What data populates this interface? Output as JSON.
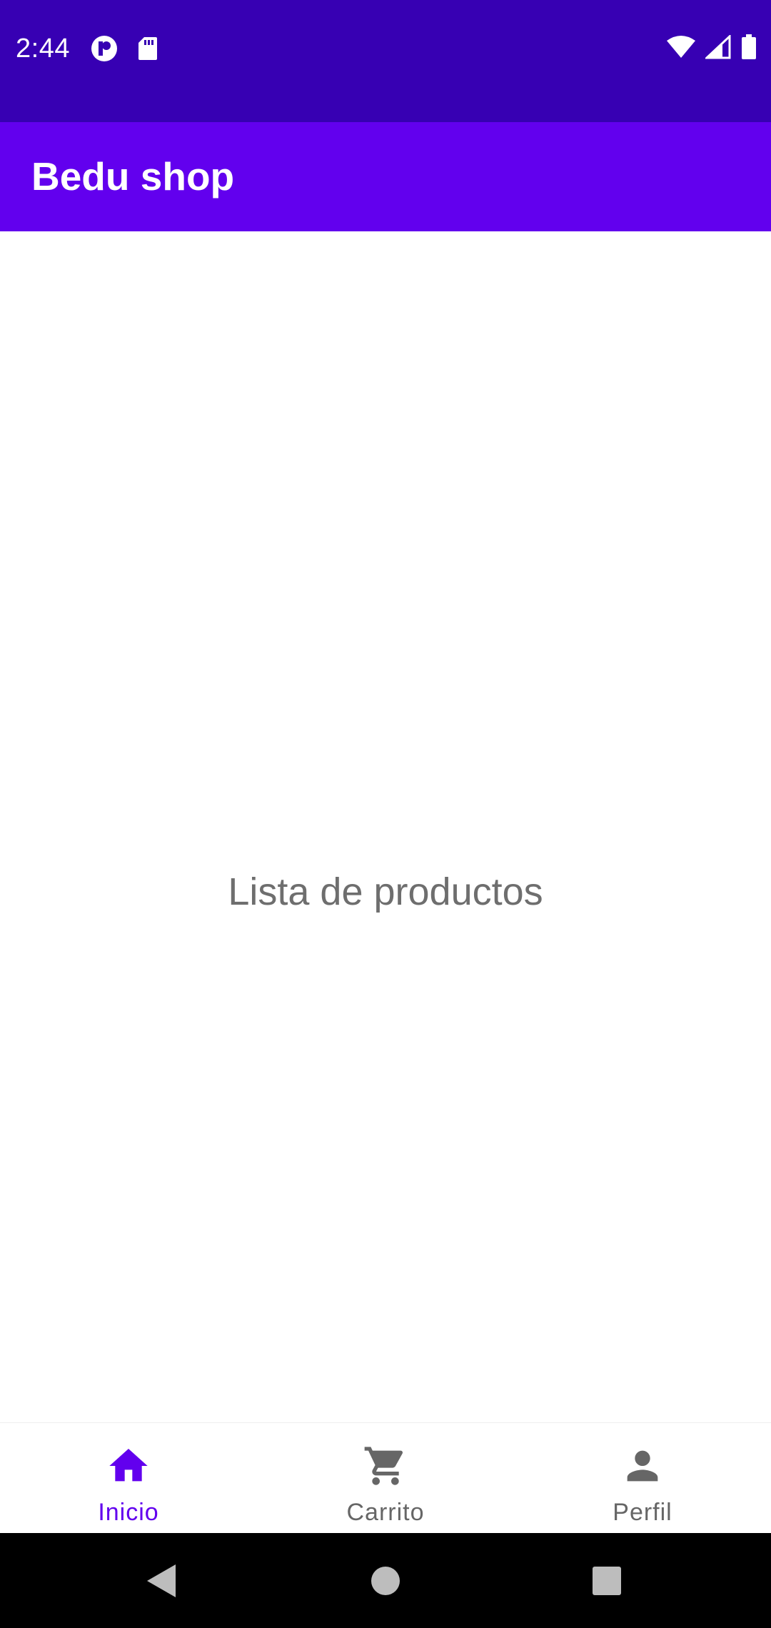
{
  "status_bar": {
    "time": "2:44",
    "left_icons": [
      "notification-app-icon",
      "sd-card-icon"
    ],
    "right_icons": [
      "wifi-icon",
      "cell-signal-icon",
      "battery-icon"
    ],
    "background_color": "#3700b3"
  },
  "app_bar": {
    "title": "Bedu shop",
    "background_color": "#6200ee"
  },
  "content": {
    "placeholder_text": "Lista de productos"
  },
  "bottom_nav": {
    "active_color": "#6200ee",
    "inactive_color": "#666666",
    "items": [
      {
        "label": "Inicio",
        "icon": "home-icon",
        "active": true
      },
      {
        "label": "Carrito",
        "icon": "cart-icon",
        "active": false
      },
      {
        "label": "Perfil",
        "icon": "person-icon",
        "active": false
      }
    ]
  },
  "system_nav": {
    "buttons": [
      "back-icon",
      "home-circle-icon",
      "recents-icon"
    ]
  }
}
